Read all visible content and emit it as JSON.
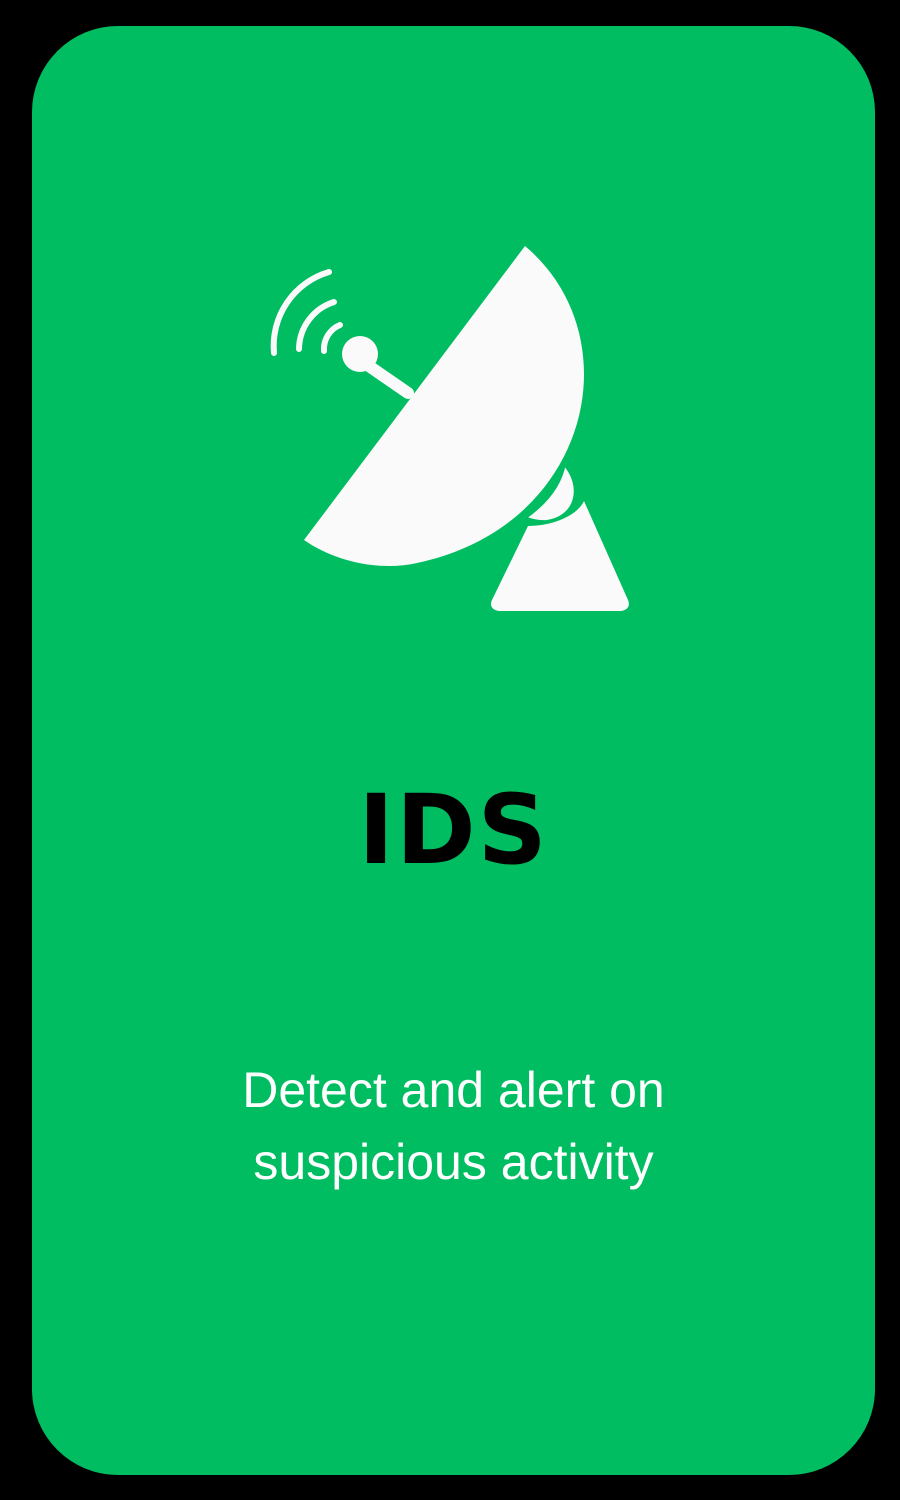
{
  "colors": {
    "frame": "#000000",
    "card_background": "#00bd62",
    "icon": "#fafafa",
    "title": "#000000",
    "description": "#ffffff"
  },
  "card": {
    "icon": "satellite-dish-icon",
    "title": "IDS",
    "description_lines": [
      "Detect and alert on",
      "suspicious activity"
    ]
  }
}
